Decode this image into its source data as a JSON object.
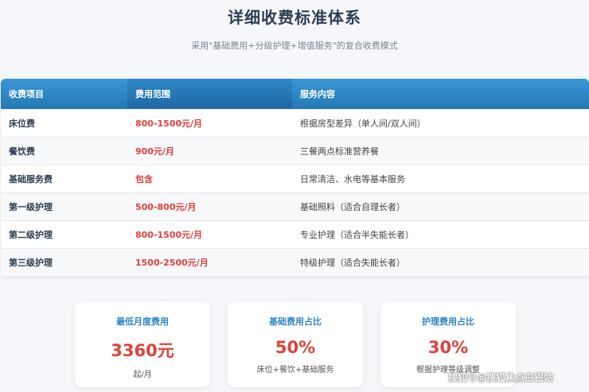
{
  "header": {
    "title": "详细收费标准体系",
    "subtitle": "采用\"基础费用+分级护理+增值服务\"的复合收费模式"
  },
  "table": {
    "columns": [
      "收费项目",
      "费用范围",
      "服务内容"
    ],
    "rows": [
      {
        "item": "床位费",
        "range": "800-1500元/月",
        "service": "根据房型差异（单人间/双人间）"
      },
      {
        "item": "餐饮费",
        "range": "900元/月",
        "service": "三餐两点标准营养餐"
      },
      {
        "item": "基础服务费",
        "range": "包含",
        "service": "日常清洁、水电等基本服务"
      },
      {
        "item": "第一级护理",
        "range": "500-800元/月",
        "service": "基础照料（适合自理长者）"
      },
      {
        "item": "第二级护理",
        "range": "800-1500元/月",
        "service": "专业护理（适合半失能长者）"
      },
      {
        "item": "第三级护理",
        "range": "1500-2500元/月",
        "service": "特级护理（适合失能长者）"
      }
    ]
  },
  "stats": [
    {
      "label": "最低月度费用",
      "value": "3360元",
      "note": "起/月"
    },
    {
      "label": "基础费用占比",
      "value": "50%",
      "note": "床位+餐饮+基础服务"
    },
    {
      "label": "护理费用占比",
      "value": "30%",
      "note": "根据护理等级调整"
    }
  ],
  "watermark": "搜狐号@搜狐焦点白银站",
  "colors": {
    "accent_blue": "#2f86c6",
    "header_blue": "#2478b5",
    "price_red": "#e0413b"
  }
}
